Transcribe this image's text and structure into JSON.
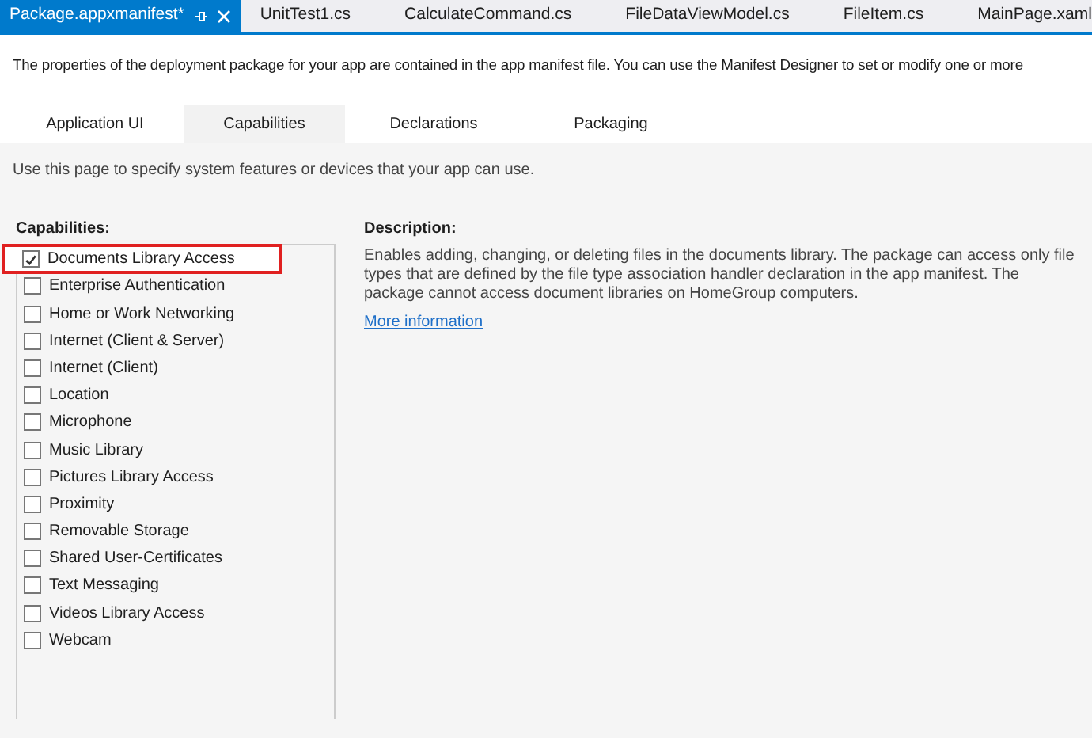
{
  "document_tabs": [
    {
      "label": "Package.appxmanifest*",
      "selected": true
    },
    {
      "label": "UnitTest1.cs",
      "selected": false
    },
    {
      "label": "CalculateCommand.cs",
      "selected": false
    },
    {
      "label": "FileDataViewModel.cs",
      "selected": false
    },
    {
      "label": "FileItem.cs",
      "selected": false
    },
    {
      "label": "MainPage.xaml",
      "selected": false
    }
  ],
  "intro": "The properties of the deployment package for your app are contained in the app manifest file. You can use the Manifest Designer to set or modify one or more",
  "designer_tabs": [
    {
      "label": "Application UI",
      "selected": false
    },
    {
      "label": "Capabilities",
      "selected": true
    },
    {
      "label": "Declarations",
      "selected": false
    },
    {
      "label": "Packaging",
      "selected": false
    }
  ],
  "hint": "Use this page to specify system features or devices that your app can use.",
  "capabilities": {
    "heading": "Capabilities:",
    "items": [
      {
        "label": "Documents Library Access",
        "checked": true,
        "highlighted": true
      },
      {
        "label": "Enterprise Authentication",
        "checked": false,
        "highlighted": false
      },
      {
        "label": "Home or Work Networking",
        "checked": false,
        "highlighted": false
      },
      {
        "label": "Internet (Client & Server)",
        "checked": false,
        "highlighted": false
      },
      {
        "label": "Internet (Client)",
        "checked": false,
        "highlighted": false
      },
      {
        "label": "Location",
        "checked": false,
        "highlighted": false
      },
      {
        "label": "Microphone",
        "checked": false,
        "highlighted": false
      },
      {
        "label": "Music Library",
        "checked": false,
        "highlighted": false
      },
      {
        "label": "Pictures Library Access",
        "checked": false,
        "highlighted": false
      },
      {
        "label": "Proximity",
        "checked": false,
        "highlighted": false
      },
      {
        "label": "Removable Storage",
        "checked": false,
        "highlighted": false
      },
      {
        "label": "Shared User-Certificates",
        "checked": false,
        "highlighted": false
      },
      {
        "label": "Text Messaging",
        "checked": false,
        "highlighted": false
      },
      {
        "label": "Videos Library Access",
        "checked": false,
        "highlighted": false
      },
      {
        "label": "Webcam",
        "checked": false,
        "highlighted": false
      }
    ]
  },
  "description": {
    "heading": "Description:",
    "text": "Enables adding, changing, or deleting files in the documents library. The package can access only file types that are defined by the file type association handler declaration in the app manifest. The package cannot access document libraries on HomeGroup computers.",
    "link": "More information"
  }
}
